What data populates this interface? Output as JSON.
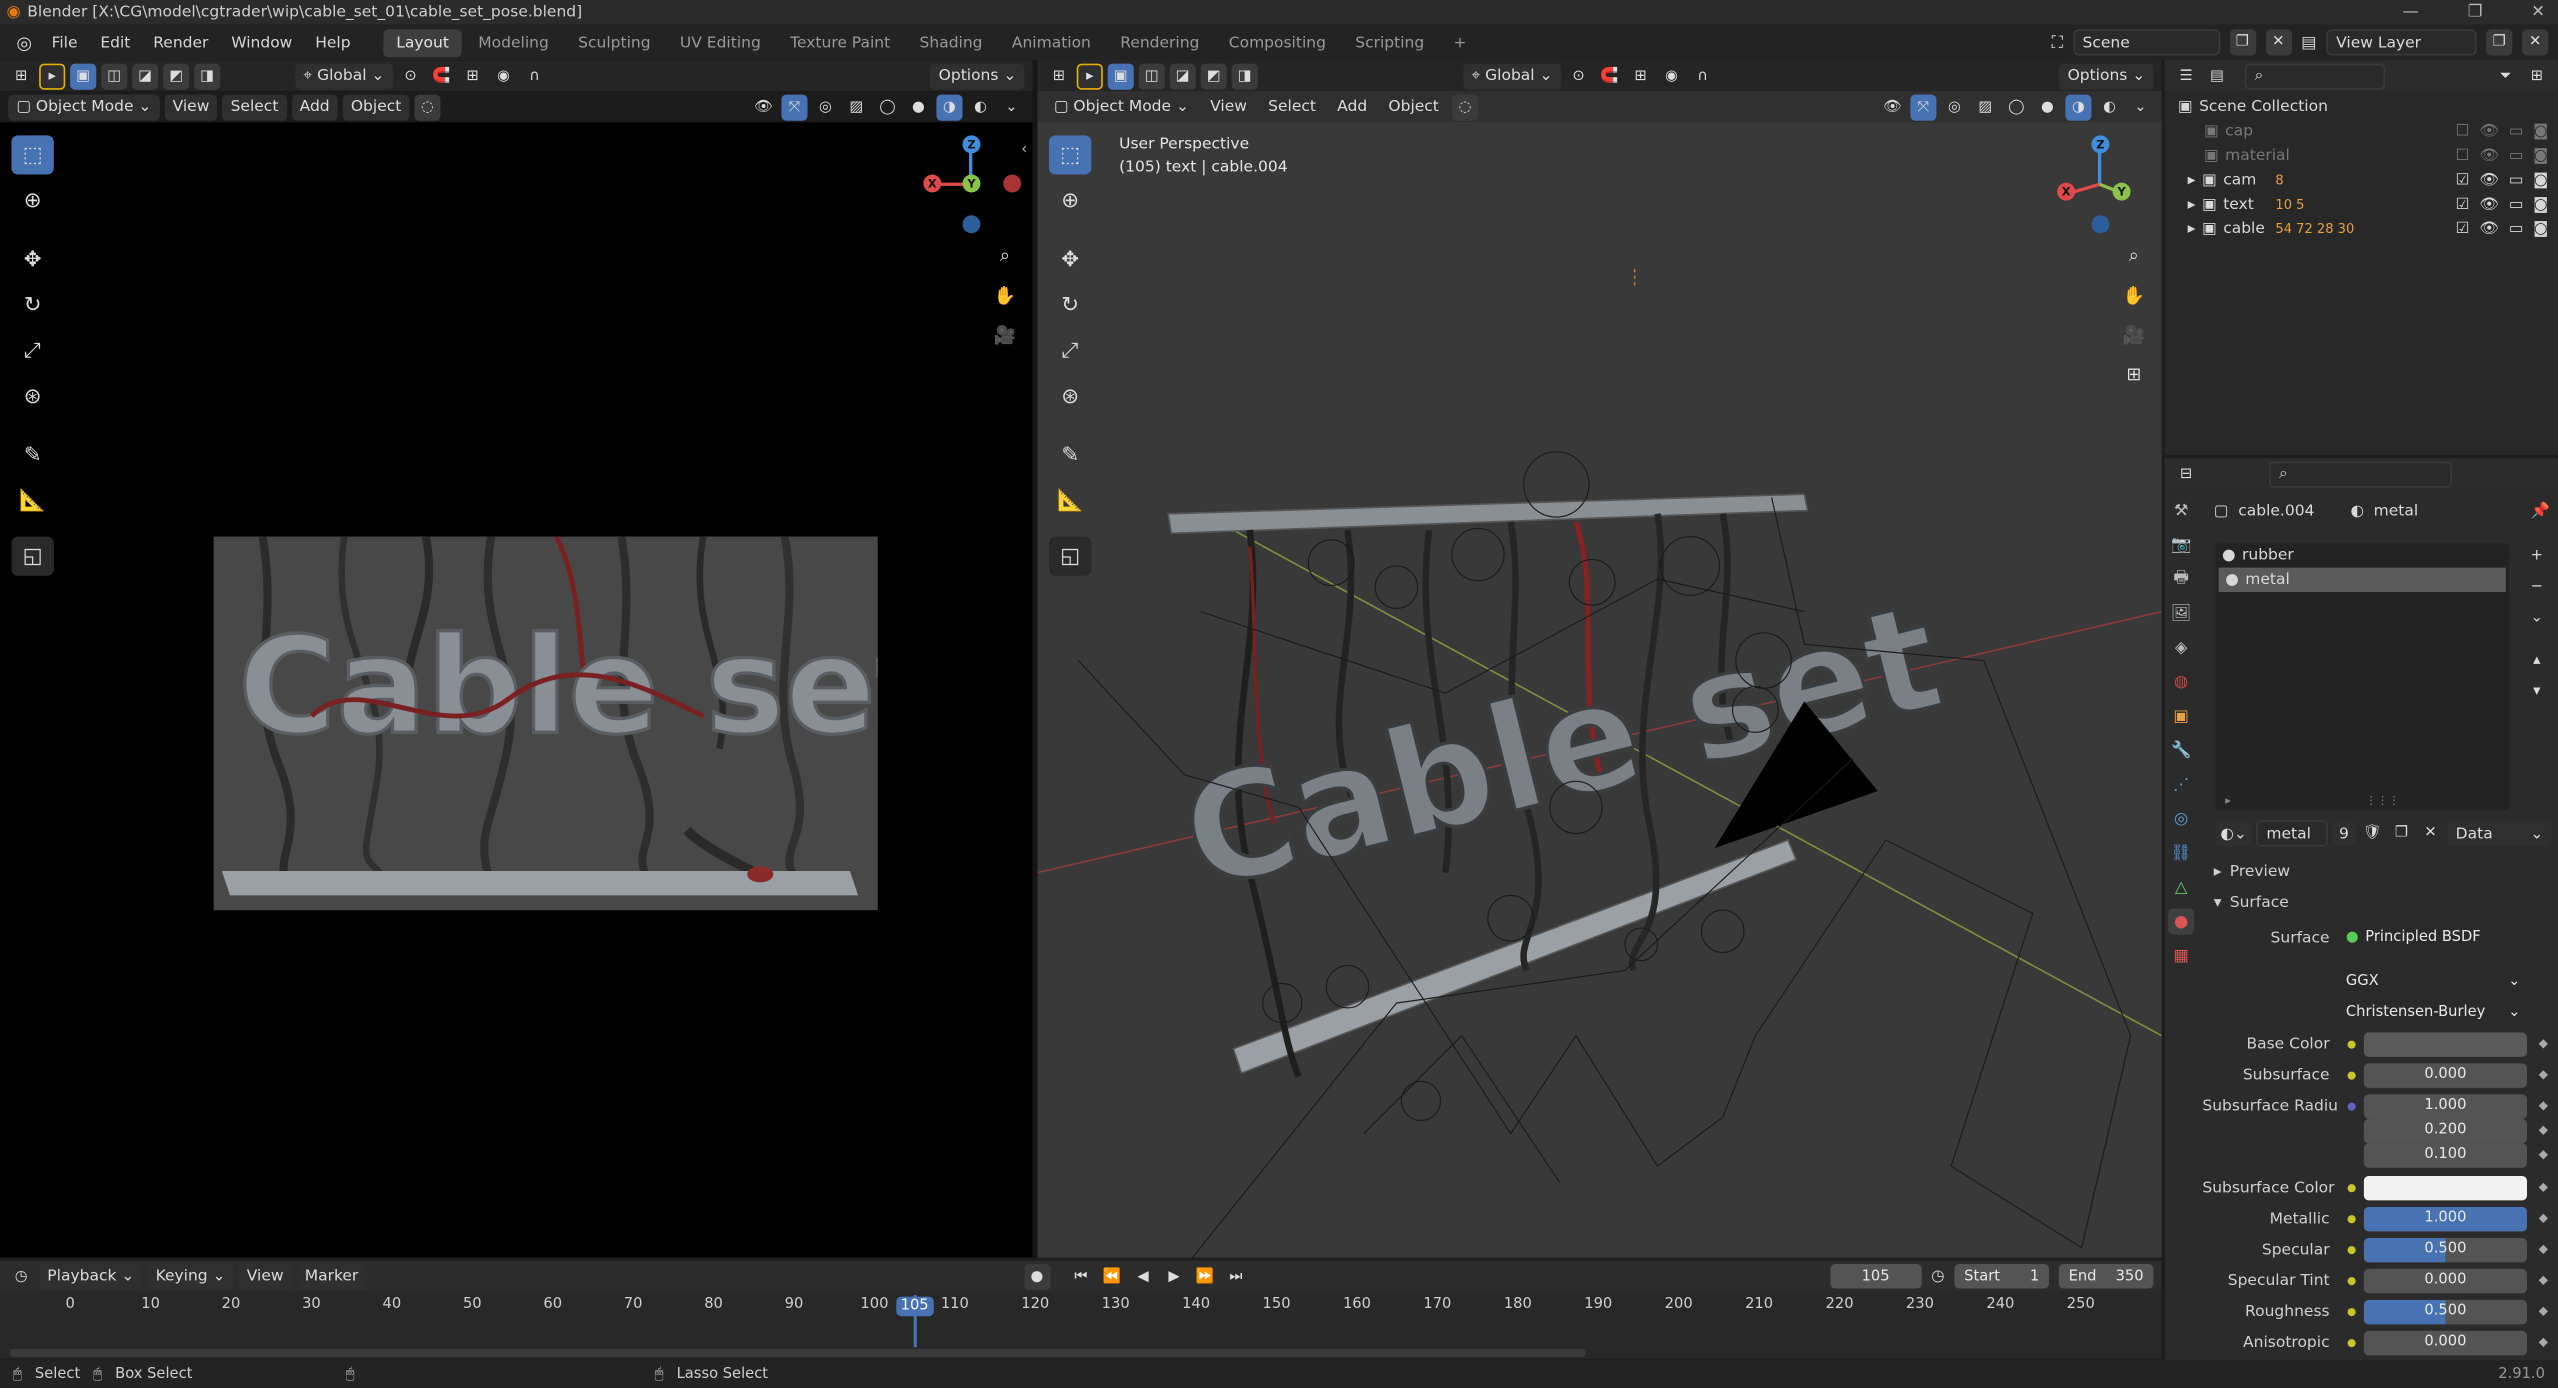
{
  "window": {
    "title": "Blender [X:\\CG\\model\\cgtrader\\wip\\cable_set_01\\cable_set_pose.blend]"
  },
  "menu": [
    "File",
    "Edit",
    "Render",
    "Window",
    "Help"
  ],
  "workspaces": [
    "Layout",
    "Modeling",
    "Sculpting",
    "UV Editing",
    "Texture Paint",
    "Shading",
    "Animation",
    "Rendering",
    "Compositing",
    "Scripting",
    "+"
  ],
  "scene": {
    "name": "Scene",
    "view_layer": "View Layer"
  },
  "left_view": {
    "orientation": "Global",
    "options": "Options",
    "mode": "Object Mode",
    "menus": [
      "View",
      "Select",
      "Add",
      "Object"
    ],
    "render_text": "Cable set"
  },
  "right_view": {
    "orientation": "Global",
    "options": "Options",
    "mode": "Object Mode",
    "menus": [
      "View",
      "Select",
      "Add",
      "Object"
    ],
    "perspective": "User Perspective",
    "info": "(105) text | cable.004",
    "overlay_text": "Cable set"
  },
  "gizmo": {
    "x": "X",
    "y": "Y",
    "z": "Z"
  },
  "outliner": {
    "root": "Scene Collection",
    "items": [
      {
        "name": "cap",
        "badge": ""
      },
      {
        "name": "material",
        "badge": ""
      },
      {
        "name": "cam",
        "badge": "8"
      },
      {
        "name": "text",
        "badge": "10  5"
      },
      {
        "name": "cable",
        "badge": "54  72  28  30"
      }
    ]
  },
  "properties": {
    "object": "cable.004",
    "material": "metal",
    "slots": [
      "rubber",
      "metal"
    ],
    "mat_name": "metal",
    "users": "9",
    "link": "Data",
    "preview": "Preview",
    "surface_panel": "Surface",
    "surface_label": "Surface",
    "surface_value": "Principled BSDF",
    "distribution": "GGX",
    "subsurface_method": "Christensen-Burley",
    "rows": [
      {
        "label": "Base Color",
        "value": "",
        "kind": "color",
        "color": "#5a5a5a"
      },
      {
        "label": "Subsurface",
        "value": "0.000",
        "fill": 0
      },
      {
        "label": "Subsurface Radiu",
        "value": "1.000",
        "fill": 0
      },
      {
        "label": "",
        "value": "0.200",
        "fill": 0
      },
      {
        "label": "",
        "value": "0.100",
        "fill": 0
      },
      {
        "label": "Subsurface Color",
        "value": "",
        "kind": "color",
        "color": "#f2f2f2"
      },
      {
        "label": "Metallic",
        "value": "1.000",
        "fill": 1
      },
      {
        "label": "Specular",
        "value": "0.500",
        "fill": 0.5
      },
      {
        "label": "Specular Tint",
        "value": "0.000",
        "fill": 0
      },
      {
        "label": "Roughness",
        "value": "0.500",
        "fill": 0.5
      },
      {
        "label": "Anisotropic",
        "value": "0.000",
        "fill": 0
      }
    ]
  },
  "timeline": {
    "menus": [
      "Playback",
      "Keying",
      "View",
      "Marker"
    ],
    "current": "105",
    "start_label": "Start",
    "start": "1",
    "end_label": "End",
    "end": "350",
    "ticks": [
      "0",
      "10",
      "20",
      "30",
      "40",
      "50",
      "60",
      "70",
      "80",
      "90",
      "100",
      "105",
      "110",
      "120",
      "130",
      "140",
      "150",
      "160",
      "170",
      "180",
      "190",
      "200",
      "210",
      "220",
      "230",
      "240",
      "250"
    ]
  },
  "status": {
    "select": "Select",
    "box_select": "Box Select",
    "lasso_select": "Lasso Select",
    "version": "2.91.0"
  },
  "colors": {
    "accent": "#4772b3",
    "x_axis": "#e04a4a",
    "y_axis": "#8bc34a",
    "z_axis": "#3f8fe0"
  }
}
